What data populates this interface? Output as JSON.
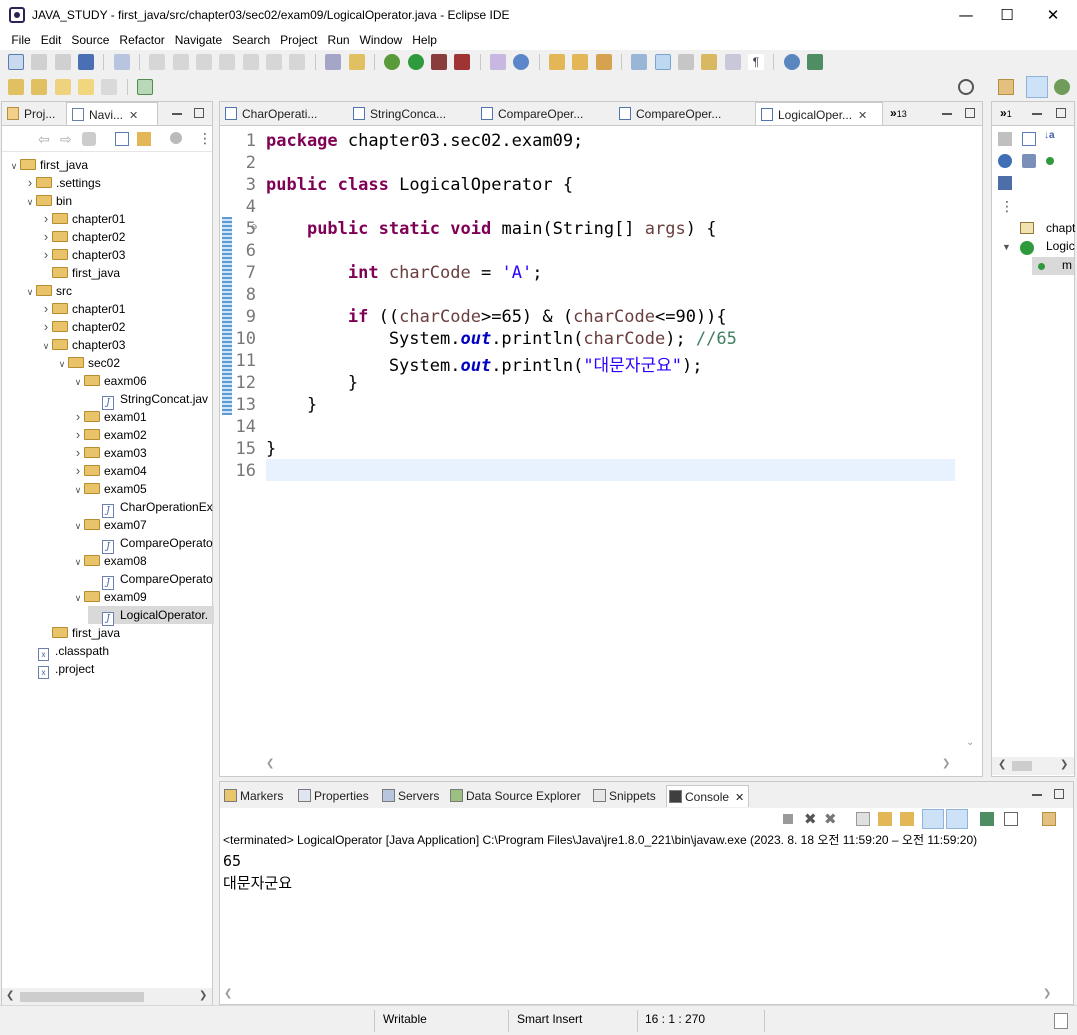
{
  "window": {
    "title": "JAVA_STUDY - first_java/src/chapter03/sec02/exam09/LogicalOperator.java - Eclipse IDE"
  },
  "menu": [
    "File",
    "Edit",
    "Source",
    "Refactor",
    "Navigate",
    "Search",
    "Project",
    "Run",
    "Window",
    "Help"
  ],
  "left_tabs": {
    "project": "Proj...",
    "navigator": "Navi..."
  },
  "tree": [
    {
      "label": "first_java",
      "depth": 0,
      "open": true,
      "type": "project"
    },
    {
      "label": ".settings",
      "depth": 1,
      "open": false,
      "type": "folder"
    },
    {
      "label": "bin",
      "depth": 1,
      "open": true,
      "type": "folder"
    },
    {
      "label": "chapter01",
      "depth": 2,
      "open": false,
      "type": "folder"
    },
    {
      "label": "chapter02",
      "depth": 2,
      "open": false,
      "type": "folder"
    },
    {
      "label": "chapter03",
      "depth": 2,
      "open": false,
      "type": "folder"
    },
    {
      "label": "first_java",
      "depth": 2,
      "open": null,
      "type": "folder"
    },
    {
      "label": "src",
      "depth": 1,
      "open": true,
      "type": "folder"
    },
    {
      "label": "chapter01",
      "depth": 2,
      "open": false,
      "type": "folder"
    },
    {
      "label": "chapter02",
      "depth": 2,
      "open": false,
      "type": "folder"
    },
    {
      "label": "chapter03",
      "depth": 2,
      "open": true,
      "type": "folder"
    },
    {
      "label": "sec02",
      "depth": 3,
      "open": true,
      "type": "folder"
    },
    {
      "label": "eaxm06",
      "depth": 4,
      "open": true,
      "type": "folder"
    },
    {
      "label": "StringConcat.jav",
      "depth": 5,
      "open": null,
      "type": "java"
    },
    {
      "label": "exam01",
      "depth": 4,
      "open": false,
      "type": "folder"
    },
    {
      "label": "exam02",
      "depth": 4,
      "open": false,
      "type": "folder"
    },
    {
      "label": "exam03",
      "depth": 4,
      "open": false,
      "type": "folder"
    },
    {
      "label": "exam04",
      "depth": 4,
      "open": false,
      "type": "folder"
    },
    {
      "label": "exam05",
      "depth": 4,
      "open": true,
      "type": "folder"
    },
    {
      "label": "CharOperationEx",
      "depth": 5,
      "open": null,
      "type": "java"
    },
    {
      "label": "exam07",
      "depth": 4,
      "open": true,
      "type": "folder"
    },
    {
      "label": "CompareOperato",
      "depth": 5,
      "open": null,
      "type": "java"
    },
    {
      "label": "exam08",
      "depth": 4,
      "open": true,
      "type": "folder"
    },
    {
      "label": "CompareOperato",
      "depth": 5,
      "open": null,
      "type": "java"
    },
    {
      "label": "exam09",
      "depth": 4,
      "open": true,
      "type": "folder"
    },
    {
      "label": "LogicalOperator.",
      "depth": 5,
      "open": null,
      "type": "java",
      "selected": true
    },
    {
      "label": "first_java",
      "depth": 2,
      "open": null,
      "type": "folder"
    },
    {
      "label": ".classpath",
      "depth": 1,
      "open": null,
      "type": "xml"
    },
    {
      "label": ".project",
      "depth": 1,
      "open": null,
      "type": "xml"
    }
  ],
  "editor_tabs": [
    "CharOperati...",
    "StringConca...",
    "CompareOper...",
    "CompareOper...",
    "LogicalOper..."
  ],
  "editor_overflow": "13",
  "code": [
    {
      "n": "1",
      "html": "<span class=\"kw\">package</span> chapter03.sec02.exam09;"
    },
    {
      "n": "2",
      "html": ""
    },
    {
      "n": "3",
      "html": "<span class=\"kw\">public</span> <span class=\"kw\">class</span> LogicalOperator {"
    },
    {
      "n": "4",
      "html": ""
    },
    {
      "n": "5",
      "html": "    <span class=\"kw\">public</span> <span class=\"kw\">static</span> <span class=\"kw\">void</span> main(String[] <span class=\"var\">args</span>) {"
    },
    {
      "n": "6",
      "html": ""
    },
    {
      "n": "7",
      "html": "        <span class=\"kw\">int</span> <span class=\"var\">charCode</span> = <span class=\"str\">'A'</span>;"
    },
    {
      "n": "8",
      "html": ""
    },
    {
      "n": "9",
      "html": "        <span class=\"kw\">if</span> ((<span class=\"var\">charCode</span>&gt;=65) &amp; (<span class=\"var\">charCode</span>&lt;=90)){"
    },
    {
      "n": "10",
      "html": "            System.<span class=\"fld\">out</span>.println(<span class=\"var\">charCode</span>); <span class=\"cmt\">//65</span>"
    },
    {
      "n": "11",
      "html": "            System.<span class=\"fld\">out</span>.println(<span class=\"str\">\"대문자군요\"</span>);"
    },
    {
      "n": "12",
      "html": "        }"
    },
    {
      "n": "13",
      "html": "    }"
    },
    {
      "n": "14",
      "html": ""
    },
    {
      "n": "15",
      "html": "}"
    },
    {
      "n": "16",
      "html": ""
    }
  ],
  "outline": {
    "item1": "chapt",
    "item2": "Logic",
    "item3": "m"
  },
  "bottom_tabs": [
    "Markers",
    "Properties",
    "Servers",
    "Data Source Explorer",
    "Snippets",
    "Console"
  ],
  "console": {
    "header": "<terminated> LogicalOperator [Java Application] C:\\Program Files\\Java\\jre1.8.0_221\\bin\\javaw.exe  (2023. 8. 18 오전 11:59:20 – 오전 11:59:20)",
    "lines": [
      "65",
      "대문자군요"
    ]
  },
  "status": {
    "writable": "Writable",
    "insert": "Smart Insert",
    "position": "16 : 1 : 270"
  }
}
